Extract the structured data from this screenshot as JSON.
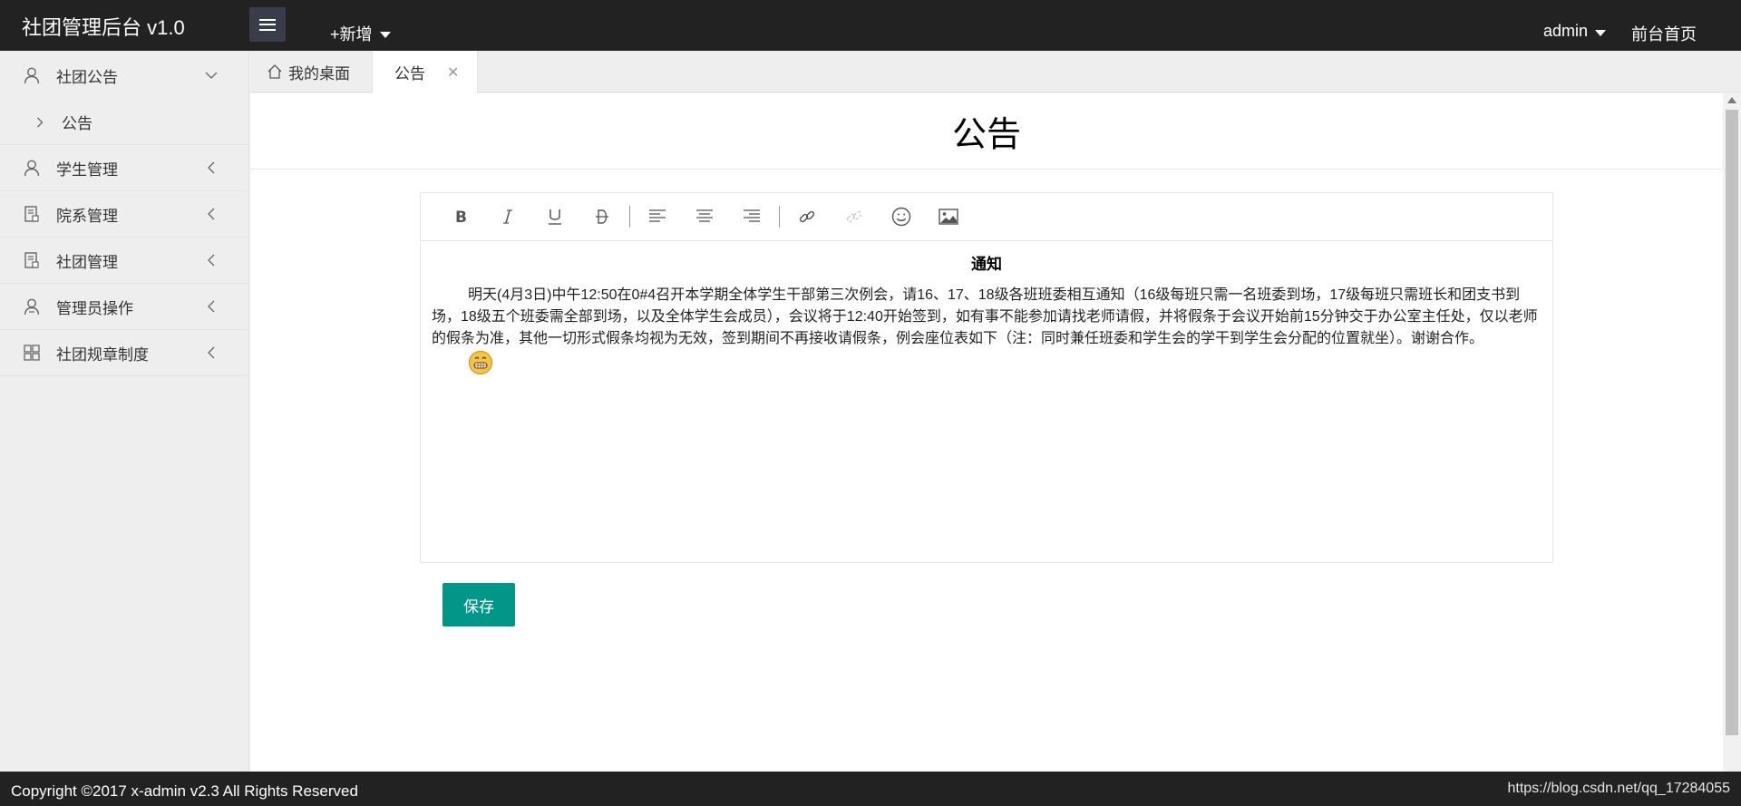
{
  "header": {
    "logo": "社团管理后台 v1.0",
    "add_new": "+新增",
    "admin": "admin",
    "front_home": "前台首页"
  },
  "sidebar": {
    "items": [
      {
        "label": "社团公告",
        "icon": "user-icon",
        "expanded": true,
        "children": [
          {
            "label": "公告"
          }
        ]
      },
      {
        "label": "学生管理",
        "icon": "user-icon"
      },
      {
        "label": "院系管理",
        "icon": "document-icon"
      },
      {
        "label": "社团管理",
        "icon": "document-icon"
      },
      {
        "label": "管理员操作",
        "icon": "admin-user-icon"
      },
      {
        "label": "社团规章制度",
        "icon": "grid-icon"
      }
    ]
  },
  "tabs": [
    {
      "label": "我的桌面",
      "icon": "home-icon"
    },
    {
      "label": "公告",
      "active": true,
      "closable": true,
      "close_symbol": "✕"
    }
  ],
  "main": {
    "heading": "公告",
    "editor": {
      "toolbar": [
        "bold",
        "italic",
        "underline",
        "strikethrough",
        "align-left",
        "align-center",
        "align-right",
        "link",
        "unlink",
        "emoji",
        "image"
      ],
      "notice_title": "通知",
      "notice_text": "明天(4月3日)中午12:50在0#4召开本学期全体学生干部第三次例会，请16、17、18级各班班委相互通知（16级每班只需一名班委到场，17级每班只需班长和团支书到场，18级五个班委需全部到场，以及全体学生会成员），会议将于12:40开始签到，如有事不能参加请找老师请假，并将假条于会议开始前15分钟交于办公室主任处，仅以老师的假条为准，其他一切形式假条均视为无效，签到期间不再接收请假条，例会座位表如下（注：同时兼任班委和学生会的学干到学生会分配的位置就坐）。谢谢合作。"
    },
    "save_label": "保存"
  },
  "footer": {
    "copyright": "Copyright ©2017 x-admin v2.3 All Rights Reserved",
    "watermark": "https://blog.csdn.net/qq_17284055"
  },
  "colors": {
    "header_bg": "#222222",
    "sidebar_bg": "#eeeeee",
    "primary_button": "#009688"
  }
}
